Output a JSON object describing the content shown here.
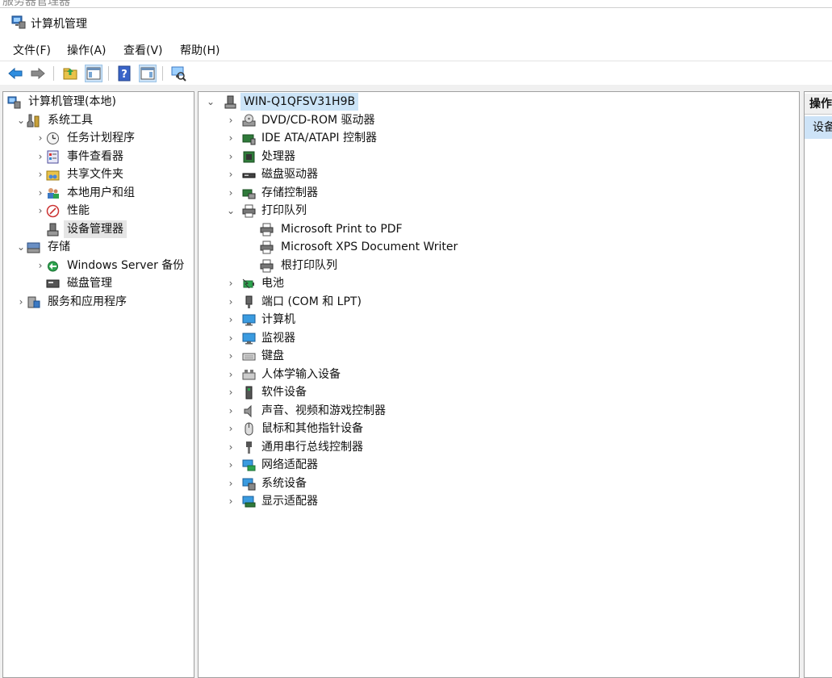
{
  "background_window_title": "服务器管理器",
  "window": {
    "title": "计算机管理"
  },
  "menu": [
    "文件(F)",
    "操作(A)",
    "查看(V)",
    "帮助(H)"
  ],
  "left_tree": [
    {
      "label": "计算机管理(本地)",
      "level": 0,
      "chevron": "",
      "icon": "computer-management-icon"
    },
    {
      "label": "系统工具",
      "level": 1,
      "chevron": "down",
      "icon": "system-tools-icon"
    },
    {
      "label": "任务计划程序",
      "level": 2,
      "chevron": "right",
      "icon": "clock-icon"
    },
    {
      "label": "事件查看器",
      "level": 2,
      "chevron": "right",
      "icon": "event-viewer-icon"
    },
    {
      "label": "共享文件夹",
      "level": 2,
      "chevron": "right",
      "icon": "shared-folder-icon"
    },
    {
      "label": "本地用户和组",
      "level": 2,
      "chevron": "right",
      "icon": "users-icon"
    },
    {
      "label": "性能",
      "level": 2,
      "chevron": "right",
      "icon": "performance-icon"
    },
    {
      "label": "设备管理器",
      "level": 2,
      "chevron": "",
      "icon": "device-manager-icon",
      "selected": true
    },
    {
      "label": "存储",
      "level": 1,
      "chevron": "down",
      "icon": "storage-icon"
    },
    {
      "label": "Windows Server 备份",
      "level": 2,
      "chevron": "right",
      "icon": "backup-icon"
    },
    {
      "label": "磁盘管理",
      "level": 2,
      "chevron": "",
      "icon": "disk-management-icon"
    },
    {
      "label": "服务和应用程序",
      "level": 1,
      "chevron": "right",
      "icon": "services-icon"
    }
  ],
  "device_tree": {
    "root": "WIN-Q1QFSV31H9B",
    "items": [
      {
        "label": "DVD/CD-ROM 驱动器",
        "level": 1,
        "chevron": "right",
        "icon": "dvd-icon"
      },
      {
        "label": "IDE ATA/ATAPI 控制器",
        "level": 1,
        "chevron": "right",
        "icon": "ide-controller-icon"
      },
      {
        "label": "处理器",
        "level": 1,
        "chevron": "right",
        "icon": "processor-icon"
      },
      {
        "label": "磁盘驱动器",
        "level": 1,
        "chevron": "right",
        "icon": "disk-drive-icon"
      },
      {
        "label": "存储控制器",
        "level": 1,
        "chevron": "right",
        "icon": "storage-controller-icon"
      },
      {
        "label": "打印队列",
        "level": 1,
        "chevron": "down",
        "icon": "printer-icon"
      },
      {
        "label": "Microsoft Print to PDF",
        "level": 2,
        "chevron": "",
        "icon": "printer-icon"
      },
      {
        "label": "Microsoft XPS Document Writer",
        "level": 2,
        "chevron": "",
        "icon": "printer-icon"
      },
      {
        "label": "根打印队列",
        "level": 2,
        "chevron": "",
        "icon": "printer-icon"
      },
      {
        "label": "电池",
        "level": 1,
        "chevron": "right",
        "icon": "battery-icon"
      },
      {
        "label": "端口 (COM 和 LPT)",
        "level": 1,
        "chevron": "right",
        "icon": "port-icon"
      },
      {
        "label": "计算机",
        "level": 1,
        "chevron": "right",
        "icon": "monitor-icon"
      },
      {
        "label": "监视器",
        "level": 1,
        "chevron": "right",
        "icon": "monitor-icon"
      },
      {
        "label": "键盘",
        "level": 1,
        "chevron": "right",
        "icon": "keyboard-icon"
      },
      {
        "label": "人体学输入设备",
        "level": 1,
        "chevron": "right",
        "icon": "hid-icon"
      },
      {
        "label": "软件设备",
        "level": 1,
        "chevron": "right",
        "icon": "software-device-icon"
      },
      {
        "label": "声音、视频和游戏控制器",
        "level": 1,
        "chevron": "right",
        "icon": "speaker-icon"
      },
      {
        "label": "鼠标和其他指针设备",
        "level": 1,
        "chevron": "right",
        "icon": "mouse-icon"
      },
      {
        "label": "通用串行总线控制器",
        "level": 1,
        "chevron": "right",
        "icon": "usb-icon"
      },
      {
        "label": "网络适配器",
        "level": 1,
        "chevron": "right",
        "icon": "network-adapter-icon"
      },
      {
        "label": "系统设备",
        "level": 1,
        "chevron": "right",
        "icon": "system-device-icon"
      },
      {
        "label": "显示适配器",
        "level": 1,
        "chevron": "right",
        "icon": "display-adapter-icon"
      }
    ]
  },
  "actions_pane": {
    "header": "操作",
    "item": "设备管理器"
  }
}
